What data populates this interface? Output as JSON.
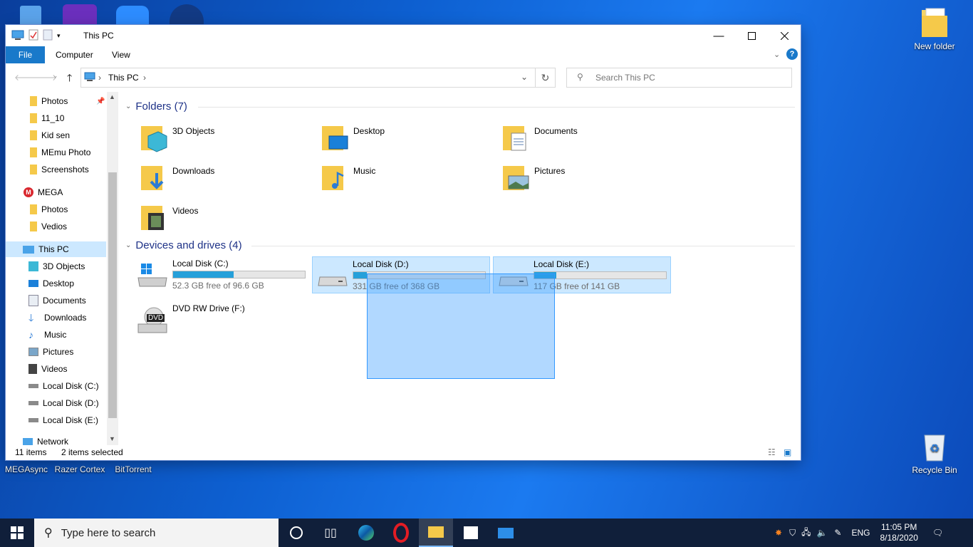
{
  "desktop": {
    "icons_right": [
      {
        "label": "New folder"
      },
      {
        "label": "Recycle Bin"
      }
    ],
    "icons_bottom": [
      {
        "label": "MEGAsync"
      },
      {
        "label": "Razer Cortex"
      },
      {
        "label": "BitTorrent"
      }
    ]
  },
  "window": {
    "title": "This PC",
    "tabs": {
      "file": "File",
      "computer": "Computer",
      "view": "View"
    },
    "address": {
      "location": "This PC"
    },
    "search": {
      "placeholder": "Search This PC"
    },
    "nav": {
      "items": [
        {
          "label": "Photos",
          "icon": "folder-icon",
          "pinned": true
        },
        {
          "label": "11_10",
          "icon": "folder-icon"
        },
        {
          "label": "Kid sen",
          "icon": "folder-icon"
        },
        {
          "label": "MEmu Photo",
          "icon": "folder-icon"
        },
        {
          "label": "Screenshots",
          "icon": "folder-icon"
        },
        {
          "label": "MEGA",
          "icon": "mega-icon"
        },
        {
          "label": "Photos",
          "icon": "folder-icon"
        },
        {
          "label": "Vedios",
          "icon": "folder-icon"
        },
        {
          "label": "This PC",
          "icon": "computer-icon",
          "selected": true
        },
        {
          "label": "3D Objects",
          "icon": "cube-icon"
        },
        {
          "label": "Desktop",
          "icon": "desktop-icon"
        },
        {
          "label": "Documents",
          "icon": "document-icon"
        },
        {
          "label": "Downloads",
          "icon": "download-icon"
        },
        {
          "label": "Music",
          "icon": "music-icon"
        },
        {
          "label": "Pictures",
          "icon": "picture-icon"
        },
        {
          "label": "Videos",
          "icon": "video-icon"
        },
        {
          "label": "Local Disk (C:)",
          "icon": "drive-icon"
        },
        {
          "label": "Local Disk (D:)",
          "icon": "drive-icon"
        },
        {
          "label": "Local Disk (E:)",
          "icon": "drive-icon"
        },
        {
          "label": "Network",
          "icon": "network-icon"
        }
      ]
    },
    "folders_group": "Folders (7)",
    "folders": [
      {
        "label": "3D Objects"
      },
      {
        "label": "Desktop"
      },
      {
        "label": "Documents"
      },
      {
        "label": "Downloads"
      },
      {
        "label": "Music"
      },
      {
        "label": "Pictures"
      },
      {
        "label": "Videos"
      }
    ],
    "drives_group": "Devices and drives (4)",
    "drives": [
      {
        "name": "Local Disk (C:)",
        "free": "52.3 GB free of 96.6 GB",
        "used_fraction": 0.46,
        "selected": false
      },
      {
        "name": "Local Disk (D:)",
        "free": "331 GB free of 368 GB",
        "used_fraction": 0.1,
        "selected": true
      },
      {
        "name": "Local Disk (E:)",
        "free": "117 GB free of 141 GB",
        "used_fraction": 0.17,
        "selected": true
      }
    ],
    "dvd": {
      "name": "DVD RW Drive (F:)",
      "badge": "DVD"
    },
    "status": {
      "items": "11 items",
      "selected": "2 items selected"
    }
  },
  "taskbar": {
    "search_placeholder": "Type here to search",
    "language": "ENG",
    "time": "11:05 PM",
    "date": "8/18/2020"
  }
}
